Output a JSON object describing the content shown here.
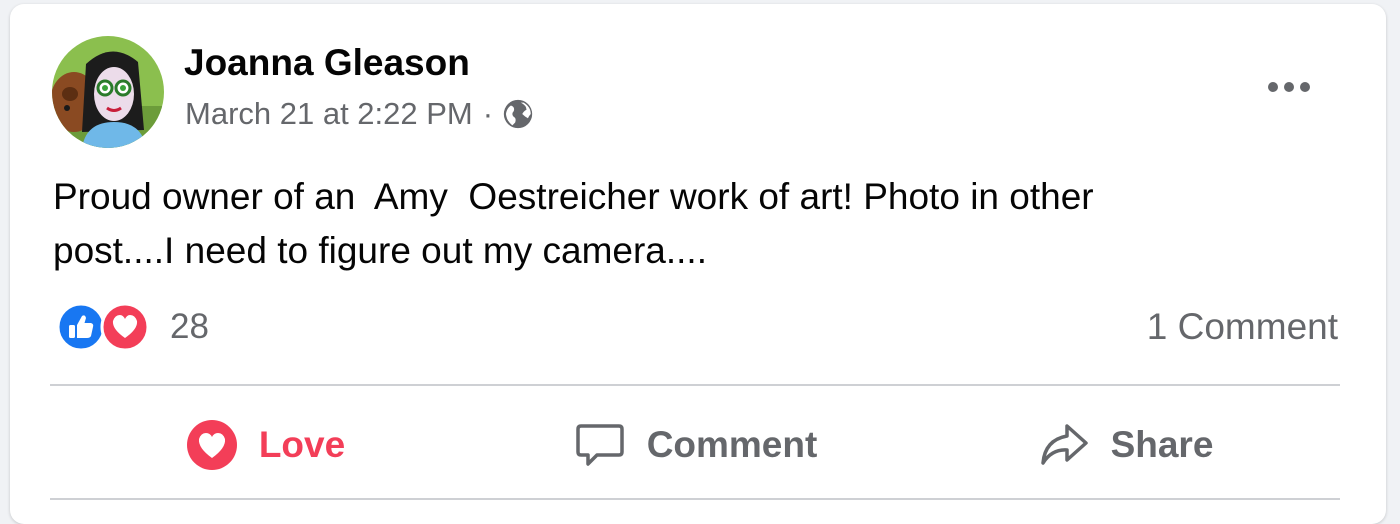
{
  "post": {
    "author": "Joanna Gleason",
    "timestamp": "March 21 at 2:22 PM",
    "separator": "·",
    "visibility_icon": "globe-icon",
    "text": "Proud owner of an  Amy  Oestreicher work of art! Photo in other\npost....I need to figure out my camera...."
  },
  "reactions": {
    "icons": [
      "like-reaction-icon",
      "love-reaction-icon"
    ],
    "count": "28",
    "comments": "1 Comment"
  },
  "actions": {
    "love_label": "Love",
    "comment_label": "Comment",
    "share_label": "Share"
  },
  "colors": {
    "love": "#f33e58",
    "like": "#1877f2",
    "secondary_text": "#65676b",
    "divider": "#ced0d4"
  }
}
